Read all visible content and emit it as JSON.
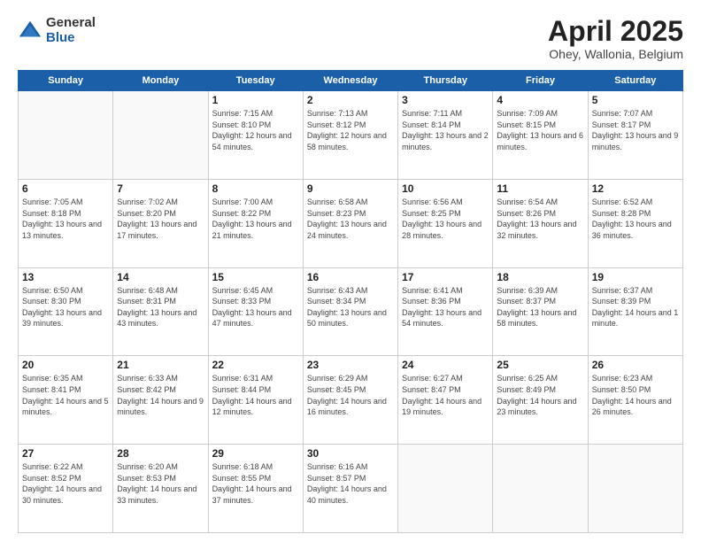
{
  "logo": {
    "general": "General",
    "blue": "Blue"
  },
  "title": {
    "month": "April 2025",
    "location": "Ohey, Wallonia, Belgium"
  },
  "days_of_week": [
    "Sunday",
    "Monday",
    "Tuesday",
    "Wednesday",
    "Thursday",
    "Friday",
    "Saturday"
  ],
  "weeks": [
    [
      {
        "day": "",
        "info": ""
      },
      {
        "day": "",
        "info": ""
      },
      {
        "day": "1",
        "info": "Sunrise: 7:15 AM\nSunset: 8:10 PM\nDaylight: 12 hours\nand 54 minutes."
      },
      {
        "day": "2",
        "info": "Sunrise: 7:13 AM\nSunset: 8:12 PM\nDaylight: 12 hours\nand 58 minutes."
      },
      {
        "day": "3",
        "info": "Sunrise: 7:11 AM\nSunset: 8:14 PM\nDaylight: 13 hours\nand 2 minutes."
      },
      {
        "day": "4",
        "info": "Sunrise: 7:09 AM\nSunset: 8:15 PM\nDaylight: 13 hours\nand 6 minutes."
      },
      {
        "day": "5",
        "info": "Sunrise: 7:07 AM\nSunset: 8:17 PM\nDaylight: 13 hours\nand 9 minutes."
      }
    ],
    [
      {
        "day": "6",
        "info": "Sunrise: 7:05 AM\nSunset: 8:18 PM\nDaylight: 13 hours\nand 13 minutes."
      },
      {
        "day": "7",
        "info": "Sunrise: 7:02 AM\nSunset: 8:20 PM\nDaylight: 13 hours\nand 17 minutes."
      },
      {
        "day": "8",
        "info": "Sunrise: 7:00 AM\nSunset: 8:22 PM\nDaylight: 13 hours\nand 21 minutes."
      },
      {
        "day": "9",
        "info": "Sunrise: 6:58 AM\nSunset: 8:23 PM\nDaylight: 13 hours\nand 24 minutes."
      },
      {
        "day": "10",
        "info": "Sunrise: 6:56 AM\nSunset: 8:25 PM\nDaylight: 13 hours\nand 28 minutes."
      },
      {
        "day": "11",
        "info": "Sunrise: 6:54 AM\nSunset: 8:26 PM\nDaylight: 13 hours\nand 32 minutes."
      },
      {
        "day": "12",
        "info": "Sunrise: 6:52 AM\nSunset: 8:28 PM\nDaylight: 13 hours\nand 36 minutes."
      }
    ],
    [
      {
        "day": "13",
        "info": "Sunrise: 6:50 AM\nSunset: 8:30 PM\nDaylight: 13 hours\nand 39 minutes."
      },
      {
        "day": "14",
        "info": "Sunrise: 6:48 AM\nSunset: 8:31 PM\nDaylight: 13 hours\nand 43 minutes."
      },
      {
        "day": "15",
        "info": "Sunrise: 6:45 AM\nSunset: 8:33 PM\nDaylight: 13 hours\nand 47 minutes."
      },
      {
        "day": "16",
        "info": "Sunrise: 6:43 AM\nSunset: 8:34 PM\nDaylight: 13 hours\nand 50 minutes."
      },
      {
        "day": "17",
        "info": "Sunrise: 6:41 AM\nSunset: 8:36 PM\nDaylight: 13 hours\nand 54 minutes."
      },
      {
        "day": "18",
        "info": "Sunrise: 6:39 AM\nSunset: 8:37 PM\nDaylight: 13 hours\nand 58 minutes."
      },
      {
        "day": "19",
        "info": "Sunrise: 6:37 AM\nSunset: 8:39 PM\nDaylight: 14 hours\nand 1 minute."
      }
    ],
    [
      {
        "day": "20",
        "info": "Sunrise: 6:35 AM\nSunset: 8:41 PM\nDaylight: 14 hours\nand 5 minutes."
      },
      {
        "day": "21",
        "info": "Sunrise: 6:33 AM\nSunset: 8:42 PM\nDaylight: 14 hours\nand 9 minutes."
      },
      {
        "day": "22",
        "info": "Sunrise: 6:31 AM\nSunset: 8:44 PM\nDaylight: 14 hours\nand 12 minutes."
      },
      {
        "day": "23",
        "info": "Sunrise: 6:29 AM\nSunset: 8:45 PM\nDaylight: 14 hours\nand 16 minutes."
      },
      {
        "day": "24",
        "info": "Sunrise: 6:27 AM\nSunset: 8:47 PM\nDaylight: 14 hours\nand 19 minutes."
      },
      {
        "day": "25",
        "info": "Sunrise: 6:25 AM\nSunset: 8:49 PM\nDaylight: 14 hours\nand 23 minutes."
      },
      {
        "day": "26",
        "info": "Sunrise: 6:23 AM\nSunset: 8:50 PM\nDaylight: 14 hours\nand 26 minutes."
      }
    ],
    [
      {
        "day": "27",
        "info": "Sunrise: 6:22 AM\nSunset: 8:52 PM\nDaylight: 14 hours\nand 30 minutes."
      },
      {
        "day": "28",
        "info": "Sunrise: 6:20 AM\nSunset: 8:53 PM\nDaylight: 14 hours\nand 33 minutes."
      },
      {
        "day": "29",
        "info": "Sunrise: 6:18 AM\nSunset: 8:55 PM\nDaylight: 14 hours\nand 37 minutes."
      },
      {
        "day": "30",
        "info": "Sunrise: 6:16 AM\nSunset: 8:57 PM\nDaylight: 14 hours\nand 40 minutes."
      },
      {
        "day": "",
        "info": ""
      },
      {
        "day": "",
        "info": ""
      },
      {
        "day": "",
        "info": ""
      }
    ]
  ]
}
